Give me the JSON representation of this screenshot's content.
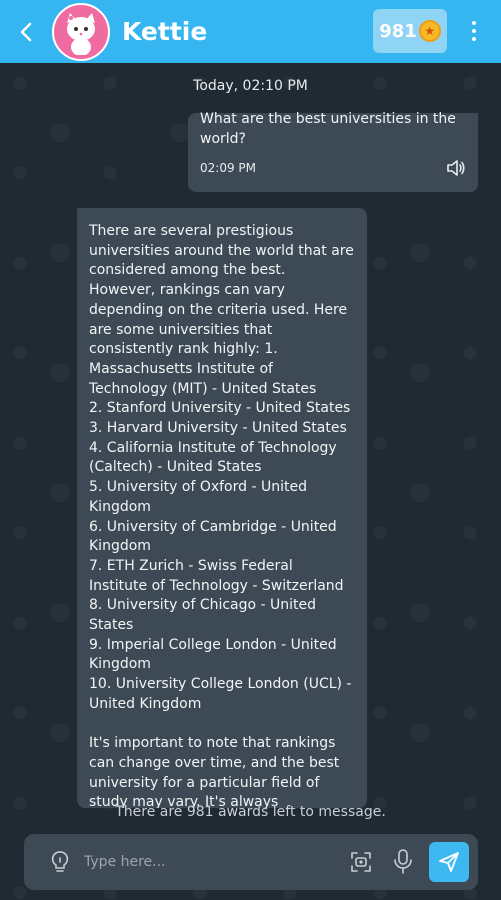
{
  "header": {
    "back_icon": "chevron-left-icon",
    "title": "Kettie",
    "awards_count": "981",
    "menu_icon": "more-vertical-icon"
  },
  "chat": {
    "date_stamp": "Today, 02:10 PM",
    "user_message": {
      "text": "What are the best universities in the world?",
      "time": "02:09 PM"
    },
    "bot_message": {
      "text": "There are several prestigious universities around the world that are considered among the best. However, rankings can vary depending on the criteria used. Here are some universities that consistently rank highly:  1. Massachusetts Institute of Technology (MIT) - United States\n2. Stanford University - United States\n3. Harvard University - United States\n4. California Institute of Technology (Caltech) - United States\n5. University of Oxford - United Kingdom\n6. University of Cambridge - United Kingdom\n7. ETH Zurich - Swiss Federal Institute of Technology - Switzerland\n8. University of Chicago - United States\n9. Imperial College London - United Kingdom\n10. University College London (UCL) - United Kingdom\n\nIt's important to note that rankings can change over time, and the best university for a particular field of study may vary. It's always"
    },
    "awards_left": "There are 981 awards left to message."
  },
  "input": {
    "placeholder": "Type here...",
    "value": ""
  },
  "colors": {
    "header_bg": "#36b6f0",
    "chat_bg": "#1f2a32",
    "bubble_bg": "#3d4a55",
    "send_button": "#3eb8f0"
  }
}
